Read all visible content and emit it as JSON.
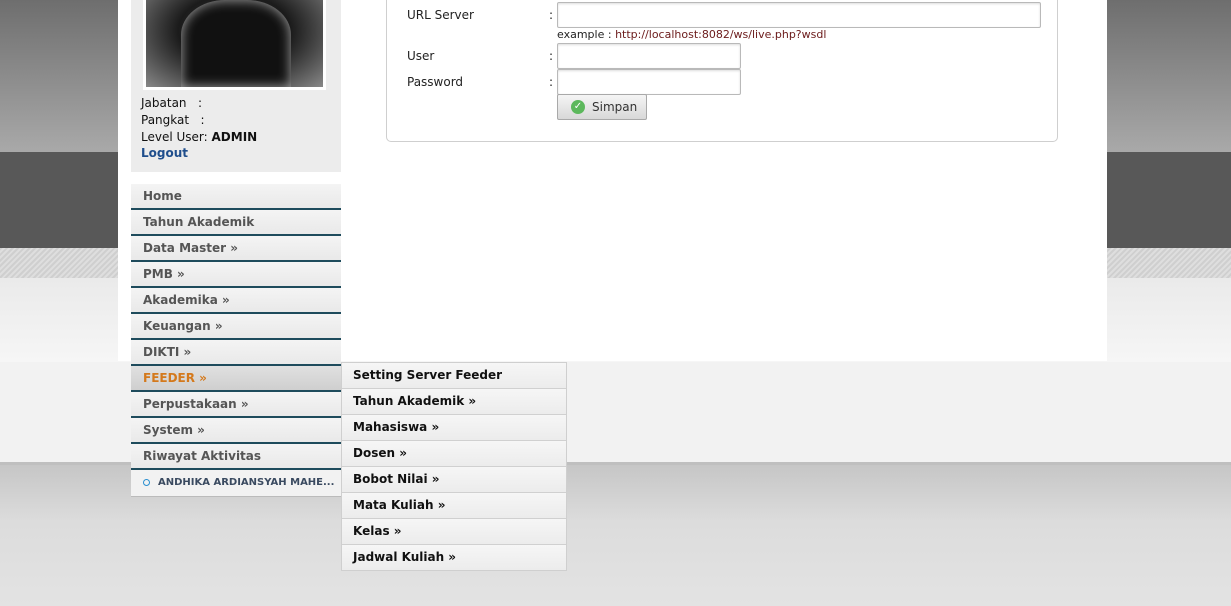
{
  "profile": {
    "jabatan_label": "Jabatan",
    "pangkat_label": "Pangkat",
    "level_label": "Level User:",
    "level_value": "ADMIN",
    "logout": "Logout"
  },
  "menu": {
    "items": [
      {
        "label": "Home"
      },
      {
        "label": "Tahun Akademik"
      },
      {
        "label": "Data Master »"
      },
      {
        "label": "PMB »"
      },
      {
        "label": "Akademika »"
      },
      {
        "label": "Keuangan »"
      },
      {
        "label": "DIKTI »"
      },
      {
        "label": "FEEDER »"
      },
      {
        "label": "Perpustakaan »"
      },
      {
        "label": "System »"
      },
      {
        "label": "Riwayat Aktivitas"
      }
    ],
    "user_name": "ANDHIKA ARDIANSYAH MAHE..."
  },
  "submenu": {
    "items": [
      {
        "label": "Setting Server Feeder"
      },
      {
        "label": "Tahun Akademik »"
      },
      {
        "label": "Mahasiswa »"
      },
      {
        "label": "Dosen »"
      },
      {
        "label": "Bobot Nilai »"
      },
      {
        "label": "Mata Kuliah »"
      },
      {
        "label": "Kelas »"
      },
      {
        "label": "Jadwal Kuliah »"
      }
    ]
  },
  "form": {
    "url_label": "URL Server",
    "example_prefix": "example :",
    "example_url": "http://localhost:8082/ws/live.php?wsdl",
    "user_label": "User",
    "password_label": "Password",
    "colon": ":",
    "url_value": "",
    "user_value": "",
    "password_value": "",
    "save_label": "Simpan"
  },
  "colors": {
    "menu_border": "#1e4b5c",
    "active_menu": "#d4791c",
    "logout_link": "#1f4e8c",
    "example_url": "#6b1a1a",
    "save_icon": "#5cb85c"
  },
  "icons": {
    "save": "check-circle-icon",
    "user_bullet": "dot-icon"
  }
}
